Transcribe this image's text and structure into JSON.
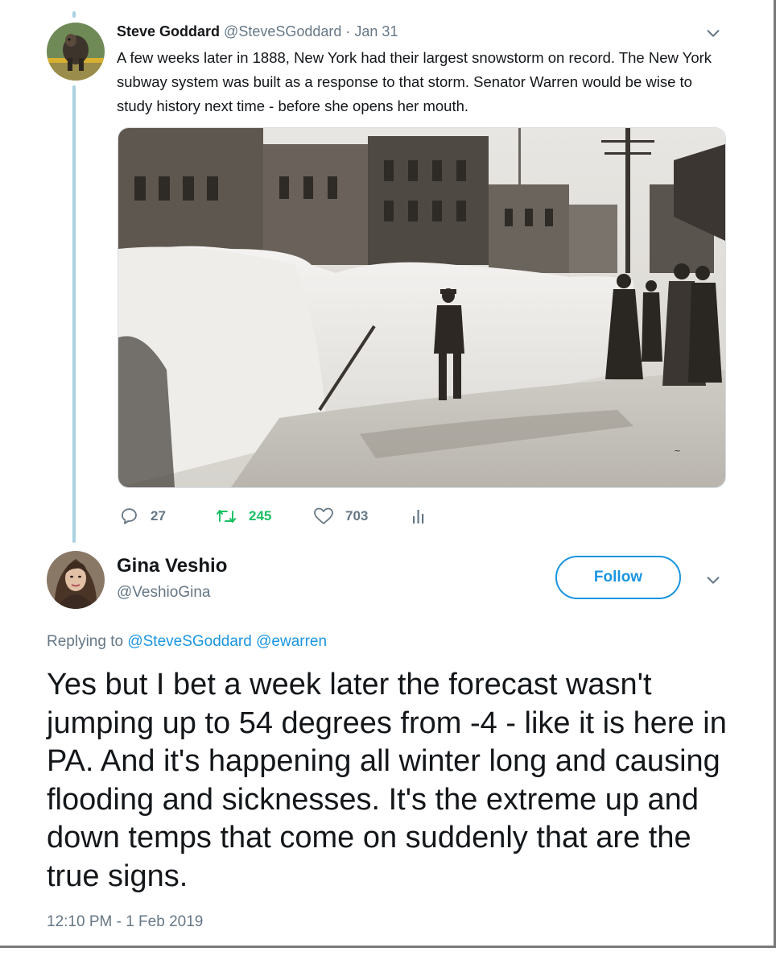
{
  "tweet1": {
    "author_name": "Steve Goddard",
    "author_handle": "@SteveSGoddard",
    "separator": " · ",
    "date": "Jan 31",
    "text": "A few weeks later in 1888, New York had their largest snowstorm on record.  The New York subway system was built as a response to that storm.  Senator Warren would be wise to study history next time - before she opens her mouth.",
    "media_description": "Historic photo of deep snowbanks on a New York street after the 1888 blizzard",
    "actions": {
      "replies": "27",
      "retweets": "245",
      "likes": "703"
    },
    "icons": [
      "reply-icon",
      "retweet-icon",
      "like-icon",
      "analytics-icon",
      "chevron-down-icon"
    ]
  },
  "tweet2": {
    "author_name": "Gina Veshio",
    "author_handle": "@VeshioGina",
    "follow_label": "Follow",
    "replying_prefix": "Replying to ",
    "mention1": "@SteveSGoddard",
    "mention2": "@ewarren",
    "text": "Yes but I bet a week later the forecast wasn't jumping up to 54 degrees from -4 - like it is here in PA. And it's happening all winter long and causing flooding and sicknesses. It's the extreme up and down temps that come on suddenly that are the true signs.",
    "timestamp": "12:10 PM - 1 Feb 2019"
  },
  "colors": {
    "accent": "#1b95e0",
    "secondary_text": "#657786",
    "retweet_green": "#17bf63",
    "thread_line": "#a8d1e2"
  }
}
